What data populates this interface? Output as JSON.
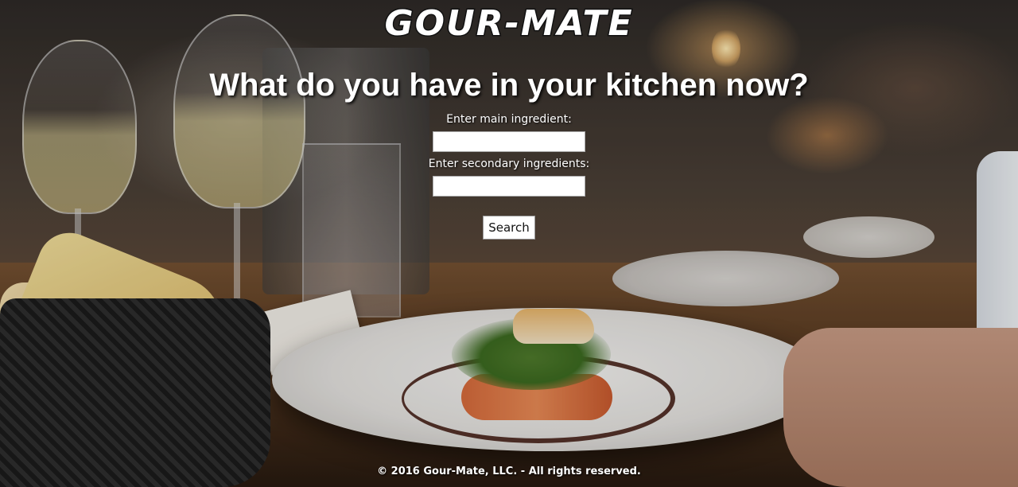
{
  "brand": {
    "logo_text": "GOUR-MATE"
  },
  "hero": {
    "headline": "What do you have in your kitchen now?"
  },
  "search_form": {
    "main_label": "Enter main ingredient:",
    "main_value": "",
    "secondary_label": "Enter secondary ingredients:",
    "secondary_value": "",
    "search_button": "Search"
  },
  "footer": {
    "copyright": "© 2016 Gour-Mate, LLC. - All rights reserved."
  },
  "background": {
    "image_subject": "restaurant-dinner-table-photo"
  }
}
